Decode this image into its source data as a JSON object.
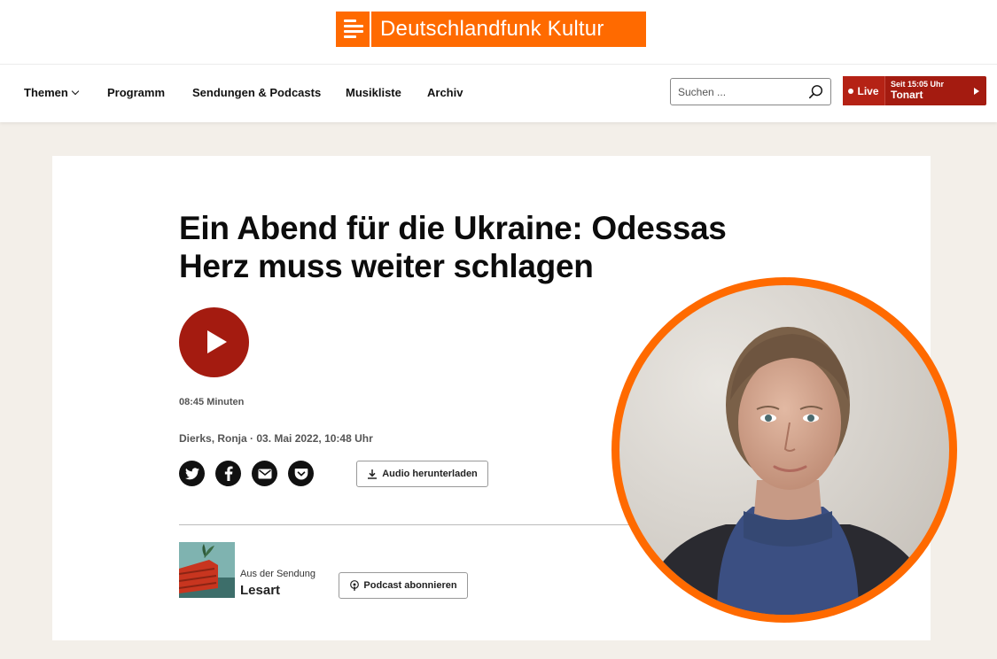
{
  "brand": {
    "name": "Deutschlandfunk Kultur",
    "color": "#ff6a00"
  },
  "nav": {
    "items": [
      {
        "label": "Themen",
        "has_dropdown": true
      },
      {
        "label": "Programm"
      },
      {
        "label": "Sendungen & Podcasts"
      },
      {
        "label": "Musikliste"
      },
      {
        "label": "Archiv"
      }
    ],
    "search": {
      "placeholder": "Suchen ...",
      "value": ""
    },
    "live": {
      "label": "Live",
      "since": "Seit 15:05 Uhr",
      "show": "Tonart",
      "color": "#a41b10"
    }
  },
  "article": {
    "title": "Ein Abend für die Ukraine: Odessas Herz muss weiter schlagen",
    "duration": "08:45 Minuten",
    "meta": "Dierks, Ronja · 03. Mai 2022, 10:48 Uhr",
    "share_icons": [
      "twitter-icon",
      "facebook-icon",
      "mail-icon",
      "pocket-icon"
    ],
    "download_label": "Audio herunterladen",
    "show": {
      "from_label": "Aus der Sendung",
      "name": "Lesart",
      "podcast_label": "Podcast abonnieren"
    }
  }
}
